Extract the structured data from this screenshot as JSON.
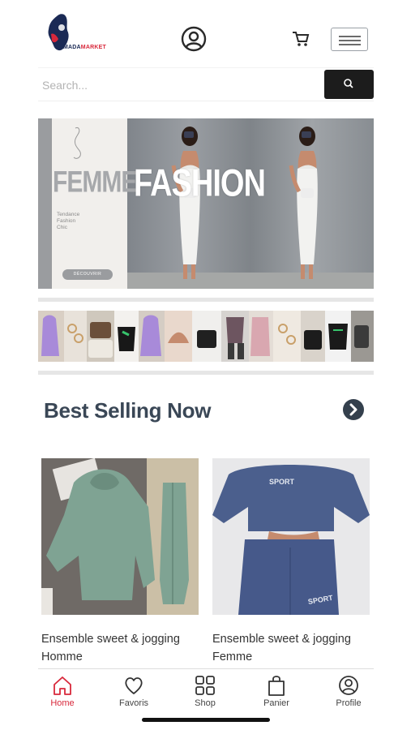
{
  "header": {
    "logo_text_a": "MADA",
    "logo_text_b": "MARKET",
    "icons": [
      "user-circle-icon",
      "cart-icon",
      "hamburger-menu-icon"
    ]
  },
  "search": {
    "placeholder": "Search...",
    "button_icon": "search-icon"
  },
  "hero": {
    "word_left": "FEMME",
    "word_right": "FASHION",
    "tags": [
      "Tendance",
      "Fashion",
      "Chic"
    ],
    "button_label": "DÉCOUVRIR"
  },
  "section": {
    "title": "Best Selling Now",
    "arrow_icon": "chevron-right-circle-icon"
  },
  "products": [
    {
      "name": "Ensemble sweet & jogging Homme",
      "color": "#7fa393"
    },
    {
      "name": "Ensemble sweet & jogging Femme",
      "color": "#4b5f8d",
      "print": "SPORT"
    }
  ],
  "bottom_nav": [
    {
      "label": "Home",
      "icon": "home-icon",
      "active": true
    },
    {
      "label": "Favoris",
      "icon": "heart-icon",
      "active": false
    },
    {
      "label": "Shop",
      "icon": "grid-icon",
      "active": false
    },
    {
      "label": "Panier",
      "icon": "shopping-bag-icon",
      "active": false
    },
    {
      "label": "Profile",
      "icon": "user-circle-icon",
      "active": false
    }
  ],
  "colors": {
    "accent": "#d8283b",
    "brand_navy": "#1b2a55",
    "title": "#3a4756",
    "search_button": "#1c1c1c"
  }
}
